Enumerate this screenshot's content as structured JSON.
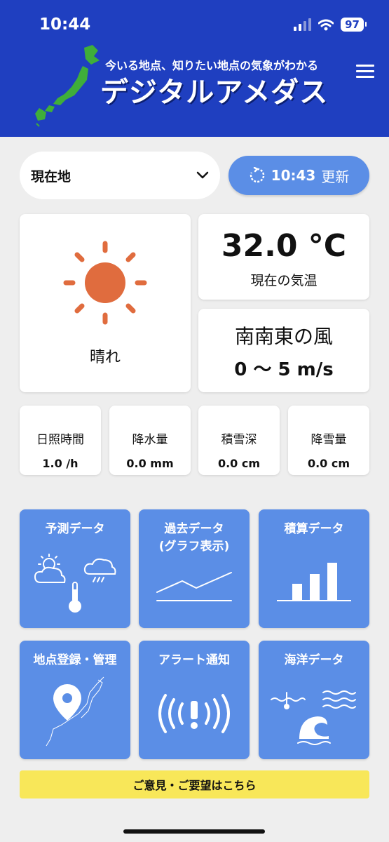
{
  "status": {
    "time": "10:44",
    "battery": "97"
  },
  "header": {
    "tagline": "今いる地点、知りたい地点の気象がわかる",
    "title": "デジタルアメダス"
  },
  "location": {
    "selected": "現在地"
  },
  "refresh": {
    "time": "10:43",
    "label": "更新"
  },
  "weather": {
    "condition": "晴れ",
    "icon": "sun-icon"
  },
  "temperature": {
    "value": "32.0 °C",
    "label": "現在の気温"
  },
  "wind": {
    "direction": "南南東の風",
    "speed": "0 ～ 5 m/s"
  },
  "stats": [
    {
      "label": "日照時間",
      "value": "1.0 /h"
    },
    {
      "label": "降水量",
      "value": "0.0 mm"
    },
    {
      "label": "積雪深",
      "value": "0.0 cm"
    },
    {
      "label": "降雪量",
      "value": "0.0 cm"
    }
  ],
  "menu_tiles": [
    {
      "label": "予測データ",
      "icon": "forecast-icon"
    },
    {
      "label": "過去データ\n(グラフ表示)",
      "icon": "line-graph-icon"
    },
    {
      "label": "積算データ",
      "icon": "bar-graph-icon"
    },
    {
      "label": "地点登録・管理",
      "icon": "map-pin-icon"
    },
    {
      "label": "アラート通知",
      "icon": "alert-icon"
    },
    {
      "label": "海洋データ",
      "icon": "ocean-icon"
    }
  ],
  "feedback": {
    "label": "ご意見・ご要望はこちら"
  },
  "colors": {
    "header": "#1f3fc0",
    "accent": "#5b8ee6",
    "sun": "#e06c3e",
    "feedback": "#f8e759"
  }
}
